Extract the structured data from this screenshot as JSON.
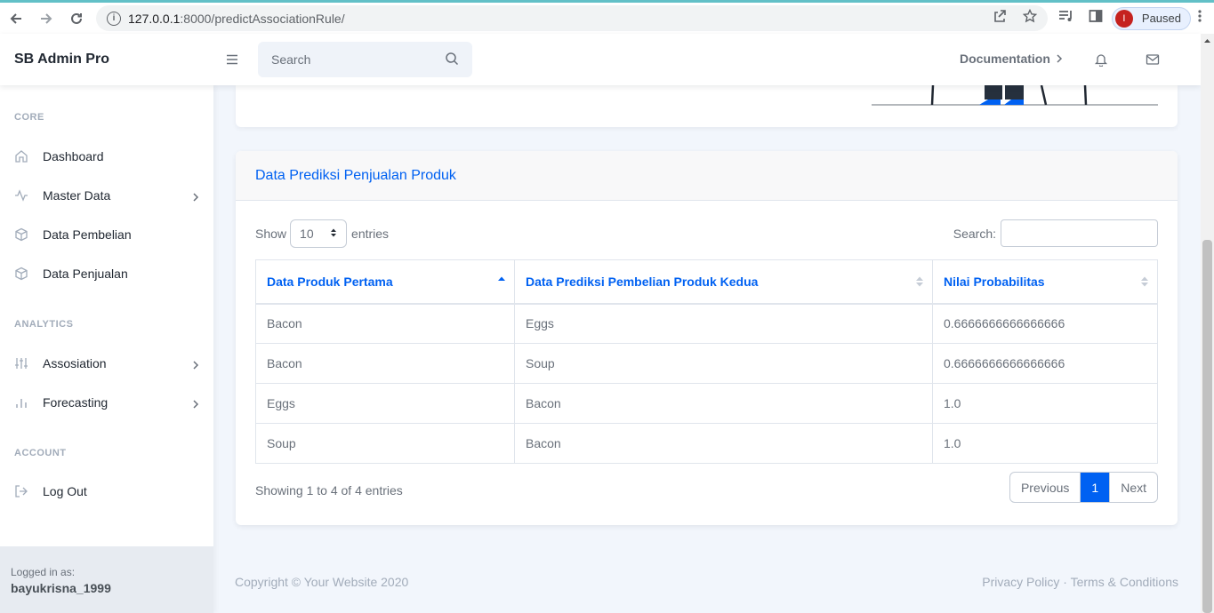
{
  "browser": {
    "url_host": "127.0.0.1",
    "url_path": ":8000/predictAssociationRule/",
    "profile_initial": "I",
    "profile_status": "Paused"
  },
  "topnav": {
    "brand": "SB Admin Pro",
    "search_placeholder": "Search",
    "documentation_label": "Documentation"
  },
  "sidebar": {
    "headings": [
      "CORE",
      "ANALYTICS",
      "ACCOUNT"
    ],
    "items": [
      {
        "label": "Dashboard"
      },
      {
        "label": "Master Data"
      },
      {
        "label": "Data Pembelian"
      },
      {
        "label": "Data Penjualan"
      },
      {
        "label": "Assosiation"
      },
      {
        "label": "Forecasting"
      },
      {
        "label": "Log Out"
      }
    ],
    "footer_label": "Logged in as:",
    "footer_user": "bayukrisna_1999"
  },
  "card": {
    "title": "Data Prediksi Penjualan Produk",
    "show_label": "Show",
    "entries_value": "10",
    "entries_label": "entries",
    "search_label": "Search:",
    "columns": [
      "Data Produk Pertama",
      "Data Prediksi Pembelian Produk Kedua",
      "Nilai Probabilitas"
    ],
    "rows": [
      [
        "Bacon",
        "Eggs",
        "0.6666666666666666"
      ],
      [
        "Bacon",
        "Soup",
        "0.6666666666666666"
      ],
      [
        "Eggs",
        "Bacon",
        "1.0"
      ],
      [
        "Soup",
        "Bacon",
        "1.0"
      ]
    ],
    "info": "Showing 1 to 4 of 4 entries",
    "pager": {
      "previous": "Previous",
      "current": "1",
      "next": "Next"
    }
  },
  "footer": {
    "copyright": "Copyright © Your Website 2020",
    "privacy": "Privacy Policy",
    "separator": "·",
    "terms": "Terms & Conditions"
  },
  "colors": {
    "accent": "#0061f2",
    "sidebar_heading": "#a2acba",
    "text": "#69707a"
  },
  "icons": {
    "dashboard": "home-icon",
    "master_data": "activity-icon",
    "data_pembelian": "package-icon",
    "data_penjualan": "package-icon",
    "assosiation": "sliders-icon",
    "forecasting": "bar-chart-icon",
    "logout": "log-out-icon"
  }
}
